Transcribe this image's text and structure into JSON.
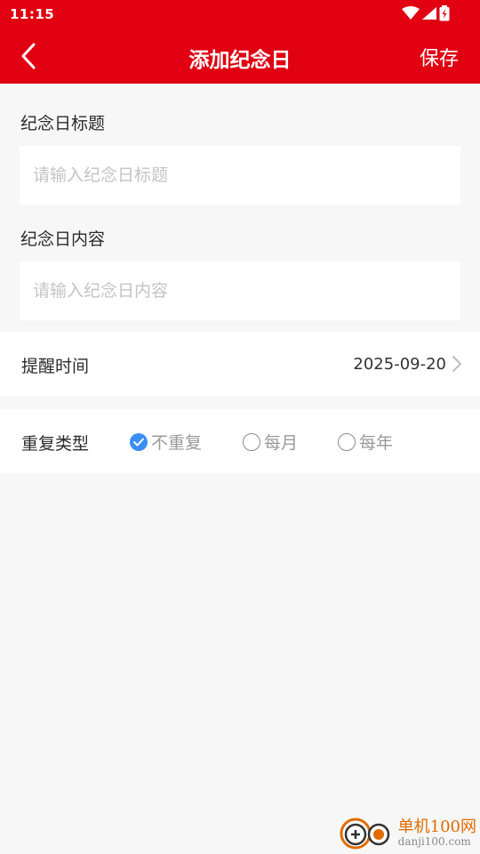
{
  "status_bar": {
    "time": "11:15"
  },
  "app_bar": {
    "title": "添加纪念日",
    "save_label": "保存"
  },
  "form": {
    "title_label": "纪念日标题",
    "title_placeholder": "请输入纪念日标题",
    "content_label": "纪念日内容",
    "content_placeholder": "请输入纪念日内容",
    "reminder_label": "提醒时间",
    "reminder_value": "2025-09-20",
    "repeat_label": "重复类型",
    "repeat_options": [
      "不重复",
      "每月",
      "每年"
    ],
    "repeat_selected": "不重复"
  },
  "colors": {
    "brand": "#e00012",
    "accent": "#3a8ef6",
    "background": "#f7f7f7"
  },
  "watermark": {
    "title": "单机100网",
    "subtitle": "danji100.com"
  }
}
